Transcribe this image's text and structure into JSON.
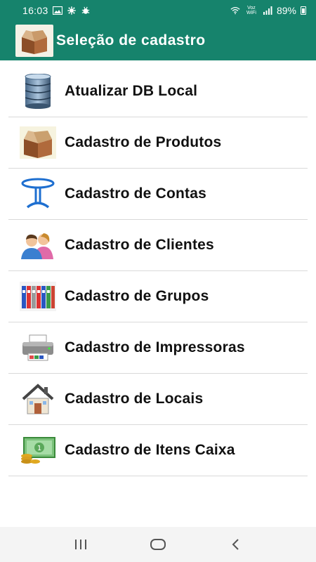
{
  "status_bar": {
    "time": "16:03",
    "battery": "89%",
    "volte": "Voz WiFi"
  },
  "app_bar": {
    "title": "Seleção de cadastro",
    "icon": "box-icon"
  },
  "menu": {
    "items": [
      {
        "label": "Atualizar DB Local",
        "icon": "database-icon"
      },
      {
        "label": "Cadastro de Produtos",
        "icon": "box-icon"
      },
      {
        "label": "Cadastro de Contas",
        "icon": "table-icon"
      },
      {
        "label": "Cadastro de Clientes",
        "icon": "users-icon"
      },
      {
        "label": "Cadastro de Grupos",
        "icon": "binders-icon"
      },
      {
        "label": "Cadastro de Impressoras",
        "icon": "printer-icon"
      },
      {
        "label": "Cadastro de Locais",
        "icon": "house-icon"
      },
      {
        "label": "Cadastro de Itens Caixa",
        "icon": "money-icon"
      }
    ]
  },
  "nav_bar": {
    "buttons": [
      "recents-icon",
      "home-icon",
      "back-icon"
    ]
  },
  "colors": {
    "primary": "#16836c",
    "divider": "#d9d9d9",
    "nav_bg": "#f4f4f4"
  }
}
